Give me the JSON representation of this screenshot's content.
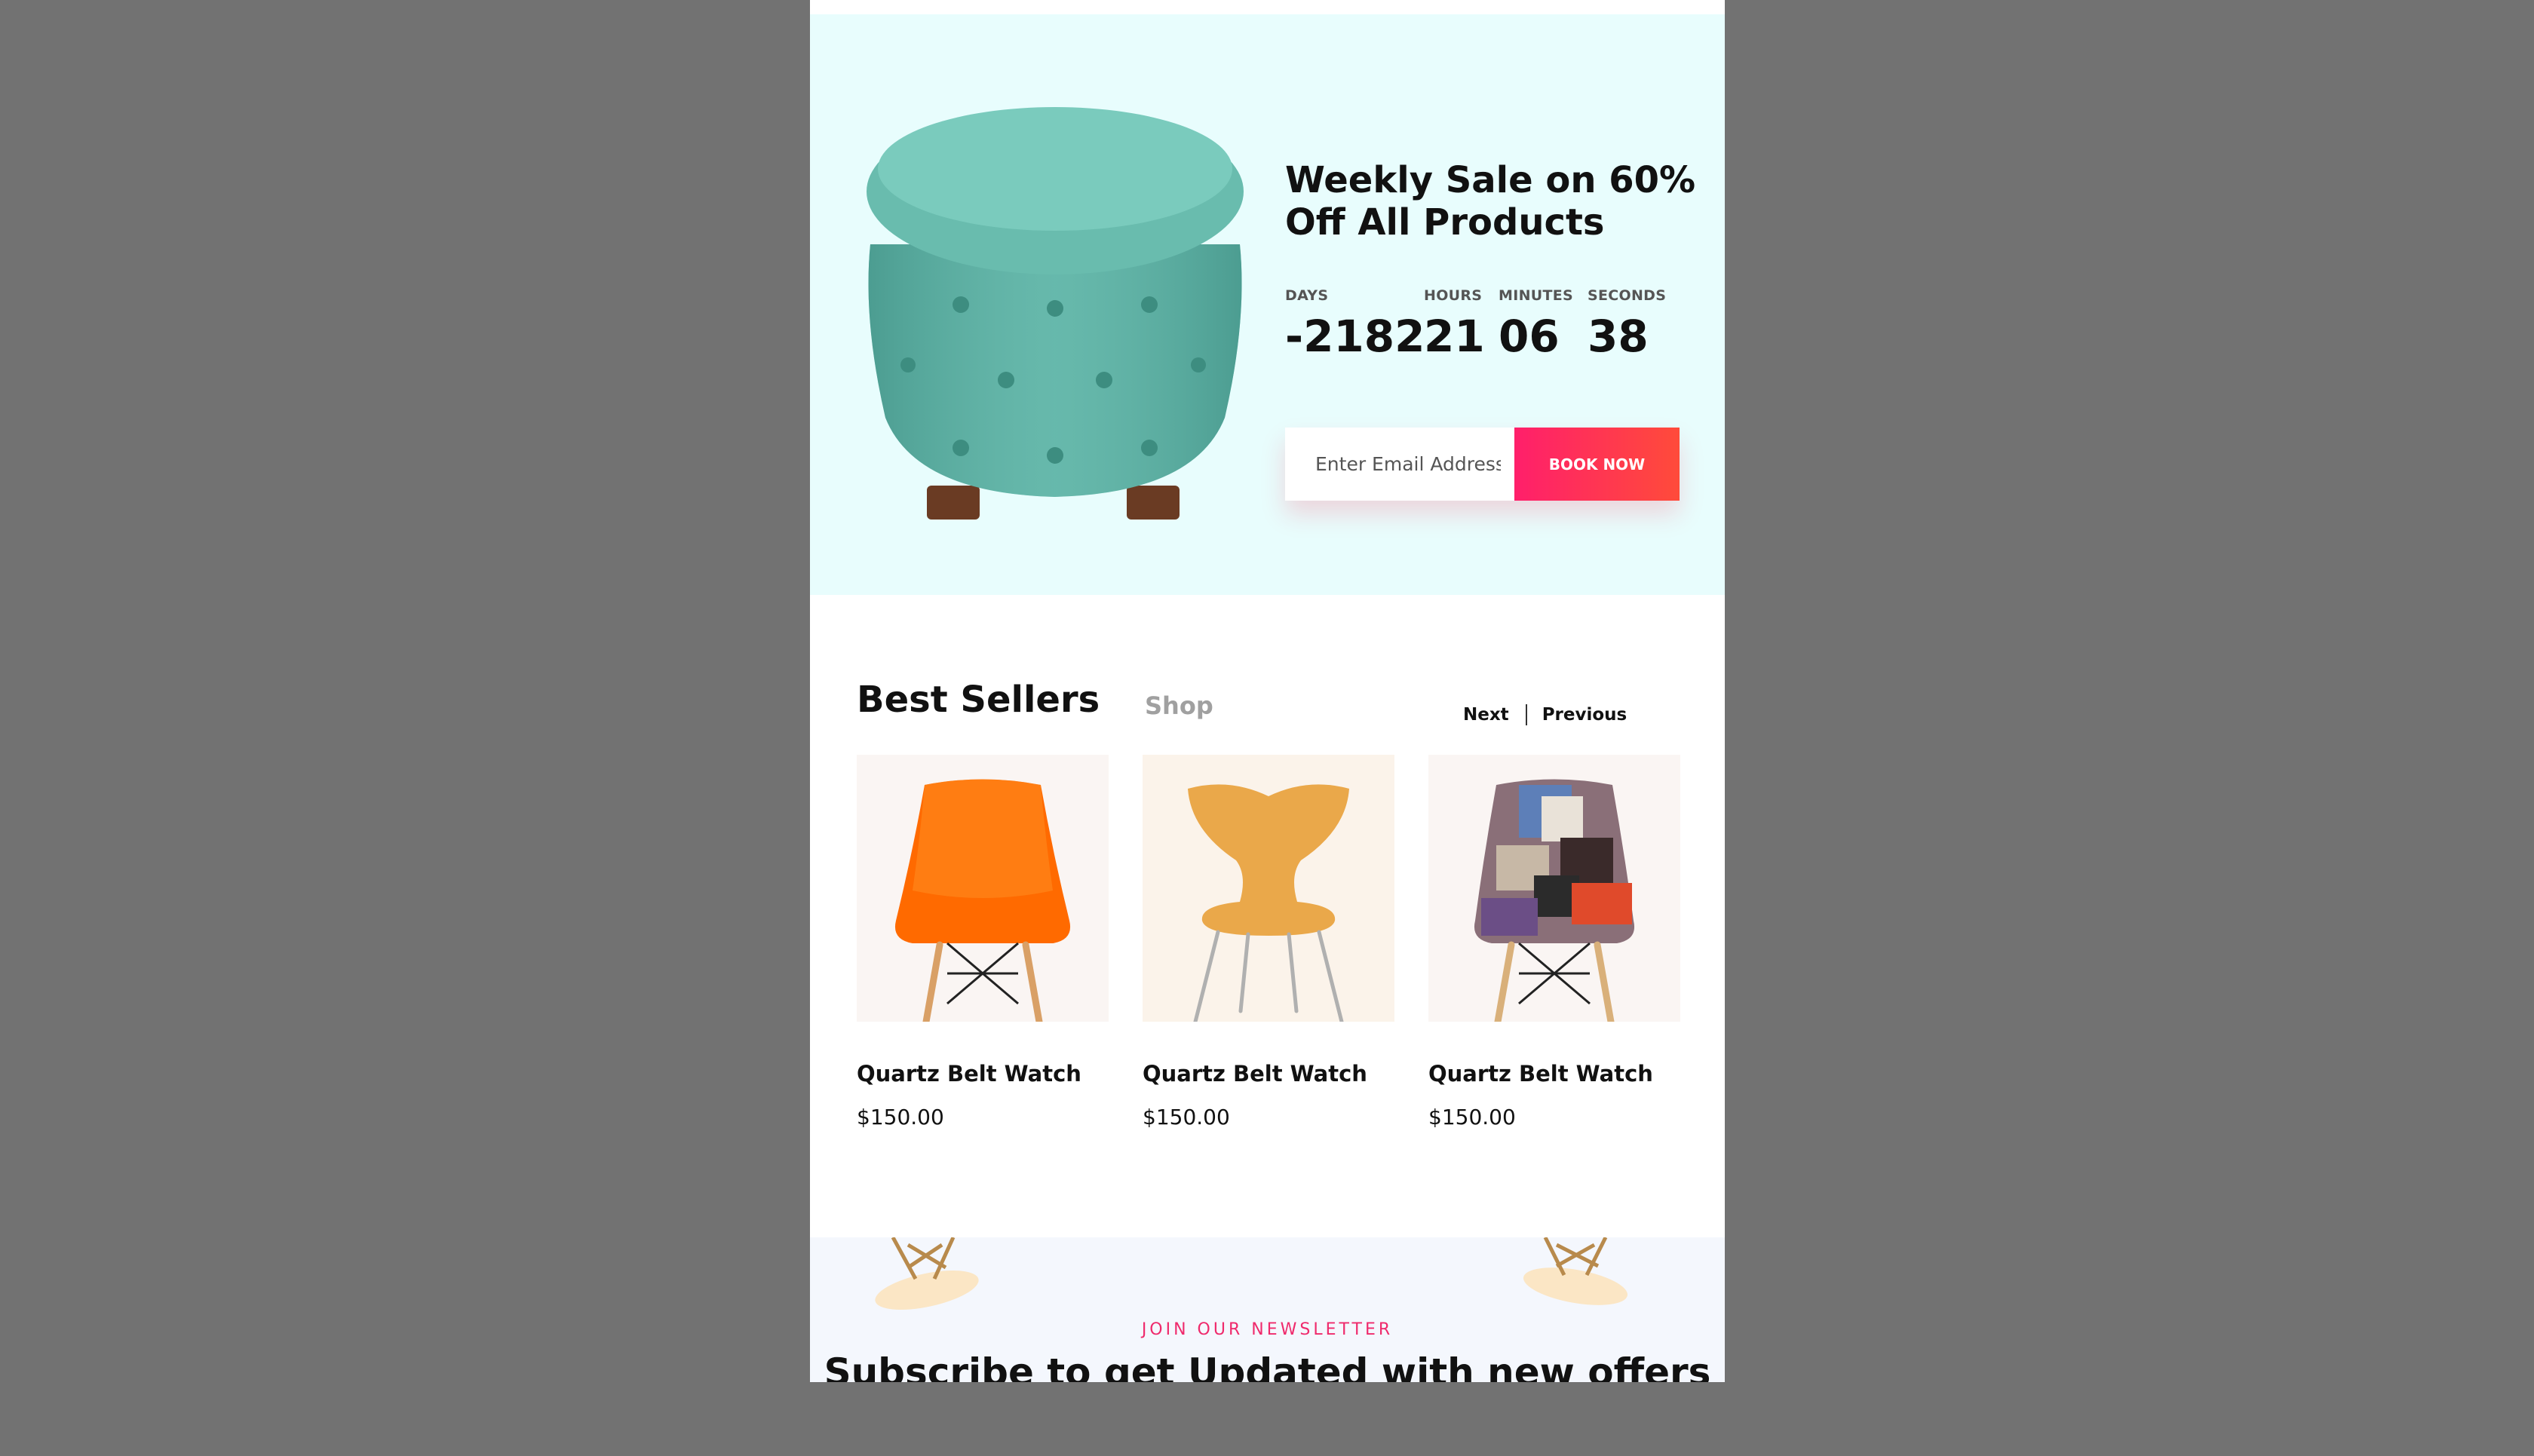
{
  "hero": {
    "title": "Weekly Sale on 60% Off All Products",
    "background": "#e8fdfd",
    "countdown": {
      "days_label": "DAYS",
      "days": "-2182",
      "hours_label": "HOURS",
      "hours": "21",
      "minutes_label": "MINUTES",
      "minutes": "06",
      "seconds_label": "SECONDS",
      "seconds": "38"
    },
    "email_placeholder": "Enter Email Address",
    "book_button": "BOOK NOW",
    "accent_from": "#ff1f6b",
    "accent_to": "#ff4b3a"
  },
  "best_sellers": {
    "title": "Best Sellers",
    "shop_link": "Shop",
    "next": "Next",
    "previous": "Previous",
    "products": [
      {
        "name": "Quartz Belt Watch",
        "price": "$150.00",
        "image": "orange-chair"
      },
      {
        "name": "Quartz Belt Watch",
        "price": "$150.00",
        "image": "yellow-chair"
      },
      {
        "name": "Quartz Belt Watch",
        "price": "$150.00",
        "image": "patchwork-chair"
      }
    ]
  },
  "newsletter": {
    "kicker": "JOIN OUR NEWSLETTER",
    "title": "Subscribe to get Updated with new offers"
  }
}
